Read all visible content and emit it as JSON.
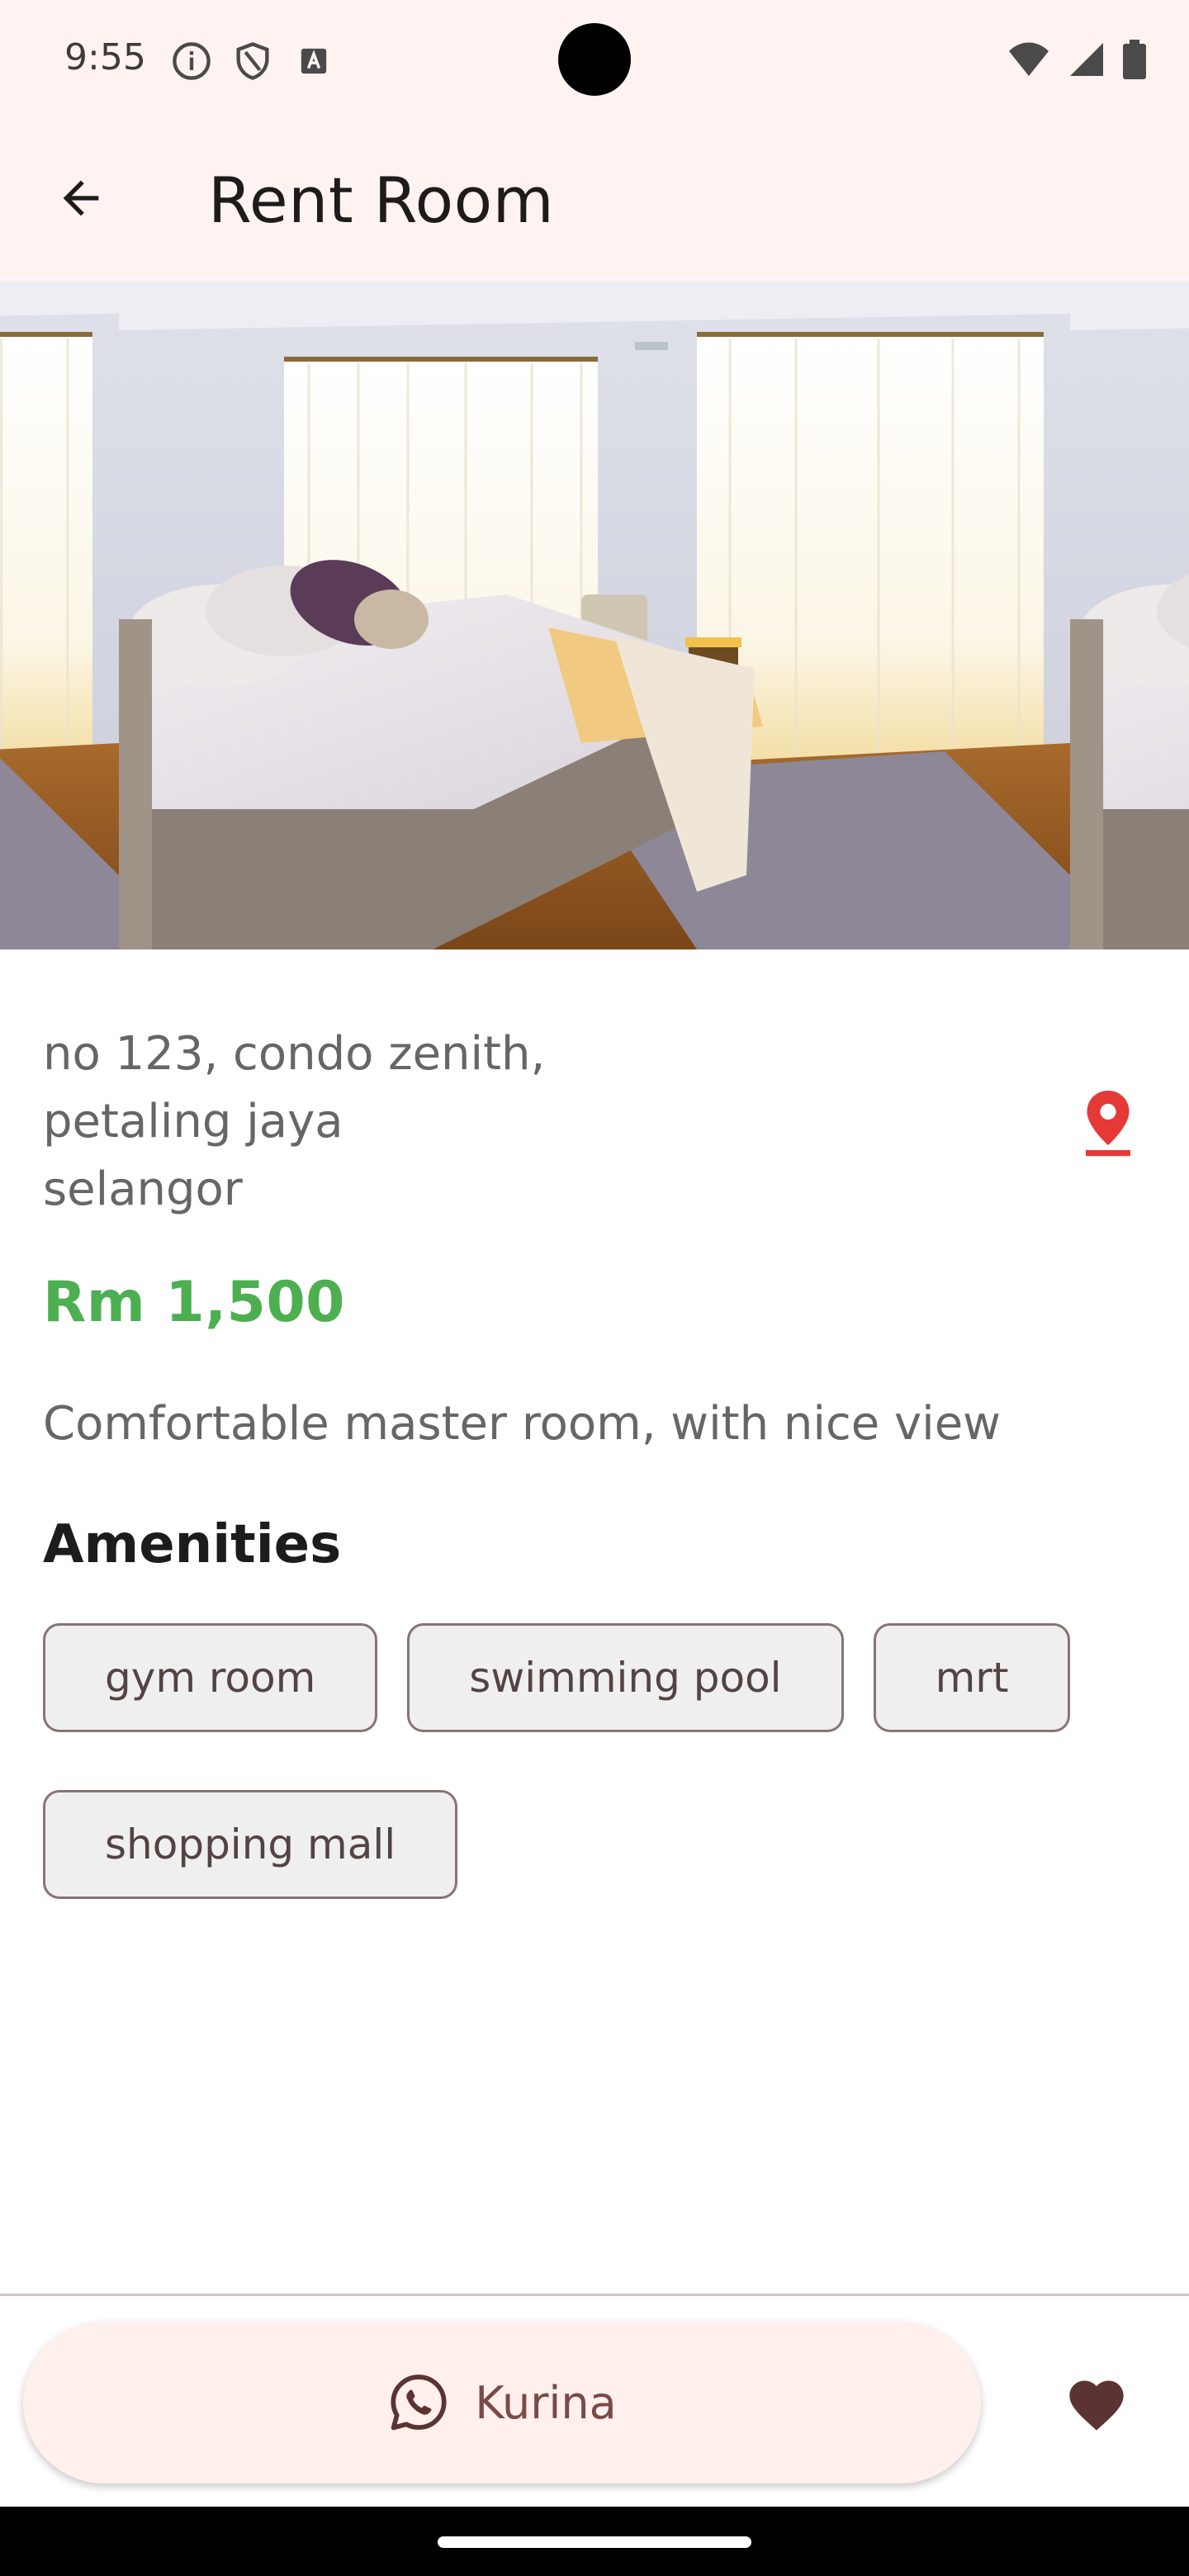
{
  "status_bar": {
    "time": "9:55"
  },
  "app_bar": {
    "title": "Rent Room"
  },
  "listing": {
    "address_lines": [
      "no 123, condo zenith,",
      "petaling jaya",
      "selangor"
    ],
    "price": "Rm 1,500",
    "description": "Comfortable master room, with nice view",
    "amenities_heading": "Amenities",
    "amenities": [
      "gym room",
      "swimming pool",
      "mrt",
      "shopping mall"
    ]
  },
  "bottom_bar": {
    "contact_label": "Kurina"
  },
  "colors": {
    "header_bg": "#fff3f1",
    "price": "#4caf50",
    "pin": "#e53935",
    "favorite": "#5a3332"
  },
  "icons": {
    "back": "arrow-left-icon",
    "location": "map-pin-icon",
    "contact": "whatsapp-icon",
    "favorite": "heart-icon"
  }
}
